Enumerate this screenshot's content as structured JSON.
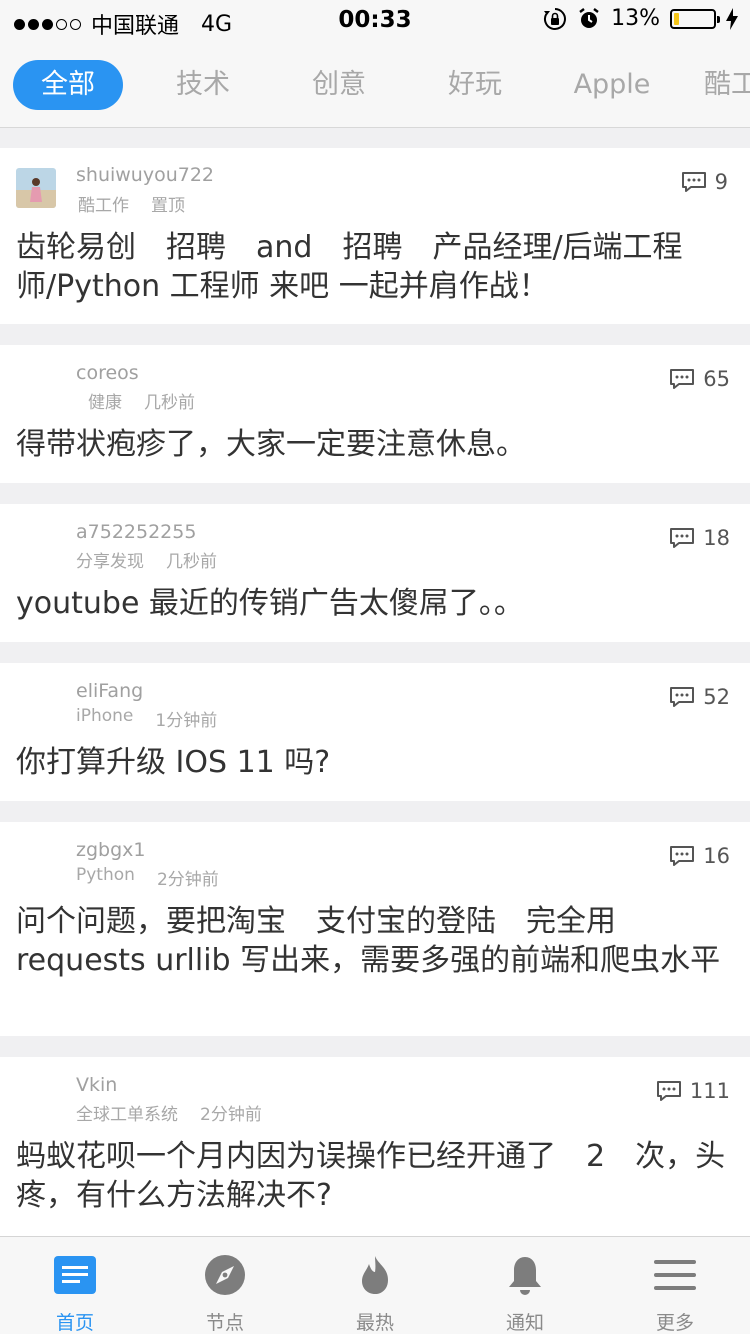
{
  "status_bar": {
    "carrier": "中国联通",
    "network": "4G",
    "time": "00:33",
    "battery_percent": "13%",
    "battery_level": 0.13,
    "battery_color": "#f5c518"
  },
  "tabs": [
    {
      "label": "全部",
      "active": true
    },
    {
      "label": "技术",
      "active": false
    },
    {
      "label": "创意",
      "active": false
    },
    {
      "label": "好玩",
      "active": false
    },
    {
      "label": "Apple",
      "active": false
    },
    {
      "label": "酷工",
      "active": false
    }
  ],
  "posts": [
    {
      "username": "shuiwuyou722",
      "node": "酷工作",
      "time": "置顶",
      "comments": "9",
      "title": "齿轮易创　招聘　and　招聘　产品经理/后端工程师/Python 工程师 来吧 一起并肩作战！",
      "has_avatar": true
    },
    {
      "username": "coreos",
      "node": "健康",
      "time": "几秒前",
      "comments": "65",
      "title": "得带状疱疹了，大家一定要注意休息。"
    },
    {
      "username": "a752252255",
      "node": "分享发现",
      "time": "几秒前",
      "comments": "18",
      "title": "youtube 最近的传销广告太傻屌了。。"
    },
    {
      "username": "eliFang",
      "node": "iPhone",
      "time": "1分钟前",
      "comments": "52",
      "title": "你打算升级 IOS 11 吗?"
    },
    {
      "username": "zgbgx1",
      "node": "Python",
      "time": "2分钟前",
      "comments": "16",
      "title": "问个问题，要把淘宝　支付宝的登陆　完全用 requests urllib 写出来，需要多强的前端和爬虫水平"
    },
    {
      "username": "Vkin",
      "node": "全球工单系统",
      "time": "2分钟前",
      "comments": "111",
      "title": "蚂蚁花呗一个月内因为误操作已经开通了　2　次，头疼，有什么方法解决不?"
    }
  ],
  "tab_bar": [
    {
      "label": "首页",
      "icon": "home-icon",
      "active": true
    },
    {
      "label": "节点",
      "icon": "compass-icon",
      "active": false
    },
    {
      "label": "最热",
      "icon": "flame-icon",
      "active": false
    },
    {
      "label": "通知",
      "icon": "bell-icon",
      "active": false
    },
    {
      "label": "更多",
      "icon": "menu-icon",
      "active": false
    }
  ],
  "colors": {
    "accent": "#2a94f2",
    "background": "#f0f0f2",
    "inactive_tab": "#a8a8a8"
  }
}
